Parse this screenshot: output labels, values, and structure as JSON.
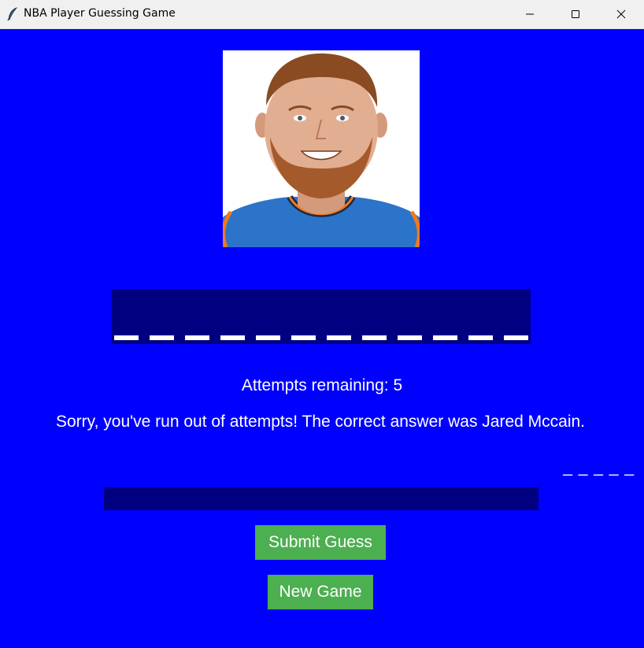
{
  "window": {
    "title": "NBA Player Guessing Game",
    "icon": "feather-icon",
    "controls": [
      "minimize-icon",
      "maximize-icon",
      "close-icon"
    ]
  },
  "colors": {
    "background": "#0000ff",
    "panel": "#000080",
    "button": "#4caf50",
    "text": "#ffffff"
  },
  "game": {
    "portrait": "player-portrait",
    "blank_count": 12,
    "attempts_text": "Attempts remaining: 5",
    "message_text": "Sorry, you've run out of attempts! The correct answer was Jared Mccain.",
    "hint_text": "_ _ _ _ _",
    "guess_value": "",
    "submit_label": "Submit Guess",
    "new_game_label": "New Game"
  }
}
